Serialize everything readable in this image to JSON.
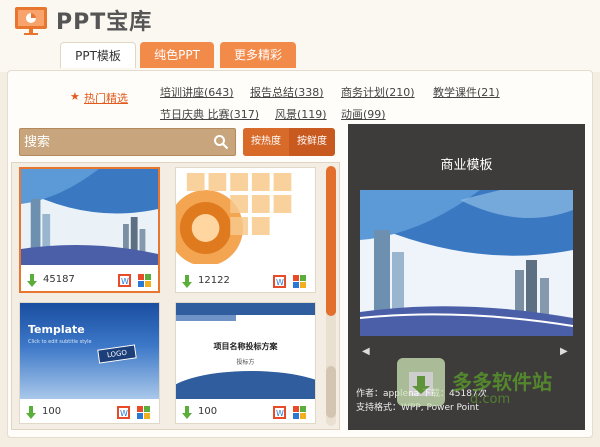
{
  "app": {
    "title": "PPT宝库"
  },
  "tabs": [
    {
      "label": "PPT模板"
    },
    {
      "label": "纯色PPT"
    },
    {
      "label": "更多精彩"
    }
  ],
  "hot": {
    "label": "热门精选"
  },
  "categories": [
    {
      "label": "培训讲座(643)"
    },
    {
      "label": "报告总结(338)"
    },
    {
      "label": "商务计划(210)"
    },
    {
      "label": "教学课件(21)"
    },
    {
      "label": "节日庆典 比赛(317)"
    },
    {
      "label": "风景(119)"
    },
    {
      "label": "动画(99)"
    }
  ],
  "search": {
    "placeholder": "搜索"
  },
  "sort": {
    "by_hot": "按热度",
    "by_new": "按鲜度"
  },
  "cards": [
    {
      "downloads": "45187"
    },
    {
      "downloads": "12122"
    },
    {
      "downloads": "100",
      "thumb_title": "Template",
      "thumb_subtitle": "Click to edit subtitle style",
      "thumb_sign": "LOGO"
    },
    {
      "downloads": "100",
      "thumb_title": "项目名称投标方案",
      "thumb_subtitle": "投标方"
    }
  ],
  "preview": {
    "title": "商业模板",
    "author_line": "作者：applena  下载：45187次",
    "format_line": "支持格式：WPP, Power Point"
  },
  "watermark": {
    "text": "多多软件站",
    "sub": "d.com"
  },
  "colors": {
    "accent": "#e8762f",
    "tab_orange": "#f28a4a",
    "panel_dark": "#3d3c3b"
  }
}
